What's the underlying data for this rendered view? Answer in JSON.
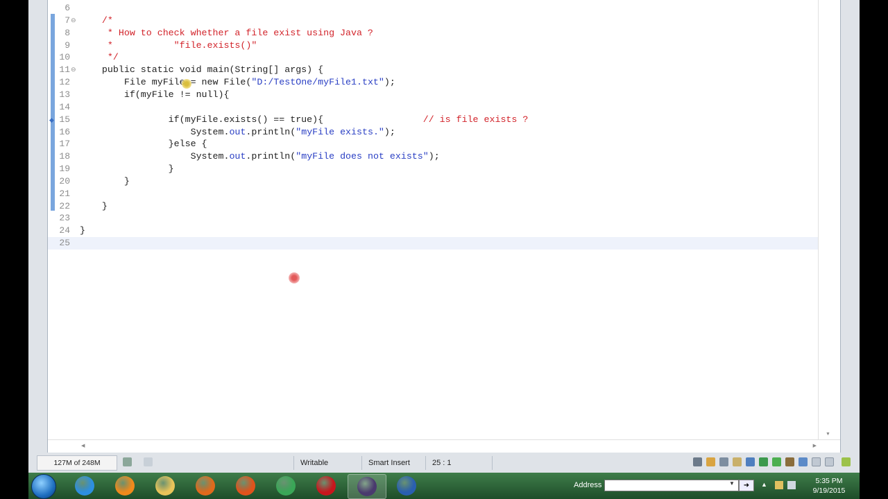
{
  "editor": {
    "lines": [
      {
        "n": "6",
        "segments": []
      },
      {
        "n": "7",
        "fold": "⊖",
        "segments": [
          {
            "t": "    /*",
            "c": "cm"
          }
        ]
      },
      {
        "n": "8",
        "segments": [
          {
            "t": "     * How to check whether a file exist using Java ?",
            "c": "cm"
          }
        ]
      },
      {
        "n": "9",
        "segments": [
          {
            "t": "     *           \"file.exists()\"",
            "c": "cm"
          }
        ]
      },
      {
        "n": "10",
        "segments": [
          {
            "t": "     */",
            "c": "cm"
          }
        ]
      },
      {
        "n": "11",
        "fold": "⊖",
        "segments": [
          {
            "t": "    public static void main(String[] args) {",
            "c": "kw"
          }
        ]
      },
      {
        "n": "12",
        "segments": [
          {
            "t": "        File myFile = new File(",
            "c": "kw"
          },
          {
            "t": "\"D:/TestOne/myFile1.txt\"",
            "c": "str"
          },
          {
            "t": ");",
            "c": "kw"
          }
        ]
      },
      {
        "n": "13",
        "segments": [
          {
            "t": "        if(myFile != null){",
            "c": "kw"
          }
        ]
      },
      {
        "n": "14",
        "segments": []
      },
      {
        "n": "15",
        "marker": "◆",
        "segments": [
          {
            "t": "                if(myFile.exists() == true){                  ",
            "c": "kw"
          },
          {
            "t": "// is file exists ?",
            "c": "cm"
          }
        ]
      },
      {
        "n": "16",
        "segments": [
          {
            "t": "                    System.",
            "c": "kw"
          },
          {
            "t": "out",
            "c": "fld"
          },
          {
            "t": ".println(",
            "c": "kw"
          },
          {
            "t": "\"myFile exists.\"",
            "c": "str"
          },
          {
            "t": ");",
            "c": "kw"
          }
        ]
      },
      {
        "n": "17",
        "segments": [
          {
            "t": "                }else {",
            "c": "kw"
          }
        ]
      },
      {
        "n": "18",
        "segments": [
          {
            "t": "                    System.",
            "c": "kw"
          },
          {
            "t": "out",
            "c": "fld"
          },
          {
            "t": ".println(",
            "c": "kw"
          },
          {
            "t": "\"myFile does not exists\"",
            "c": "str"
          },
          {
            "t": ");",
            "c": "kw"
          }
        ]
      },
      {
        "n": "19",
        "segments": [
          {
            "t": "                }",
            "c": "kw"
          }
        ]
      },
      {
        "n": "20",
        "segments": [
          {
            "t": "        }",
            "c": "kw"
          }
        ]
      },
      {
        "n": "21",
        "segments": []
      },
      {
        "n": "22",
        "segments": [
          {
            "t": "    }",
            "c": "kw"
          }
        ]
      },
      {
        "n": "23",
        "segments": []
      },
      {
        "n": "24",
        "segments": [
          {
            "t": "}",
            "c": "kw"
          }
        ]
      },
      {
        "n": "25",
        "segments": [],
        "current": true
      }
    ]
  },
  "statusbar": {
    "heap": "127M of 248M",
    "writable": "Writable",
    "insert_mode": "Smart Insert",
    "position": "25 : 1"
  },
  "taskbar": {
    "apps": [
      {
        "name": "internet-explorer-icon",
        "color": "#2d8fe0"
      },
      {
        "name": "vlc-icon",
        "color": "#f08a1c"
      },
      {
        "name": "file-explorer-icon",
        "color": "#e8c45a"
      },
      {
        "name": "media-player-icon",
        "color": "#e06a1c"
      },
      {
        "name": "firefox-icon",
        "color": "#e0531c"
      },
      {
        "name": "chrome-icon",
        "color": "#3aa757"
      },
      {
        "name": "acrobat-icon",
        "color": "#c8161d"
      },
      {
        "name": "eclipse-icon",
        "color": "#4a3a6e"
      },
      {
        "name": "save-recorder-icon",
        "color": "#2a5fb0"
      }
    ],
    "address_label": "Address",
    "address_value": "",
    "clock_time": "5:35 PM",
    "clock_date": "9/19/2015"
  }
}
